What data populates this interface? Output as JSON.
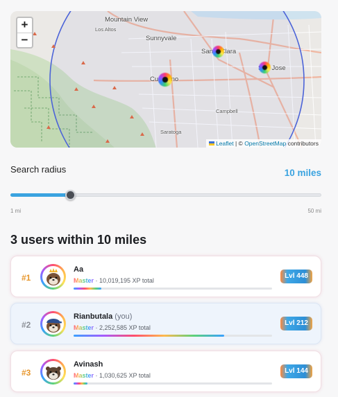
{
  "map": {
    "zoom_in": "+",
    "zoom_out": "−",
    "labels": [
      "Mountain View",
      "Los Altos",
      "Sunnyvale",
      "Santa Clara",
      "San Jose",
      "Cupertino",
      "Campbell",
      "Saratoga"
    ],
    "attribution": {
      "leaflet": "Leaflet",
      "separator": "| ©",
      "osm": "OpenStreetMap",
      "suffix": "contributors"
    }
  },
  "radius": {
    "label": "Search radius",
    "value": "10 miles",
    "min_label": "1 mi",
    "max_label": "50 mi",
    "min": 1,
    "max": 50,
    "current": 10,
    "accent": "#3aa3e0"
  },
  "results": {
    "heading": "3 users within 10 miles",
    "users": [
      {
        "rank": "#1",
        "name": "Aa",
        "you_tag": "",
        "tier": "Master",
        "xp": " · 10,019,195 XP total",
        "xp_progress": 0.14,
        "level": "Lvl 448",
        "rank_color": "#e7962b",
        "avatar": "otter-crown-icon"
      },
      {
        "rank": "#2",
        "name": "Rianbutala",
        "you_tag": "(you)",
        "tier": "Master",
        "xp": " · 2,252,585 XP total",
        "xp_progress": 0.76,
        "level": "Lvl 212",
        "rank_color": "#8b8f96",
        "avatar": "otter-cap-icon"
      },
      {
        "rank": "#3",
        "name": "Avinash",
        "you_tag": "",
        "tier": "Master",
        "xp": " · 1,030,625 XP total",
        "xp_progress": 0.07,
        "level": "Lvl 144",
        "rank_color": "#e7962b",
        "avatar": "otter-icon"
      }
    ]
  }
}
